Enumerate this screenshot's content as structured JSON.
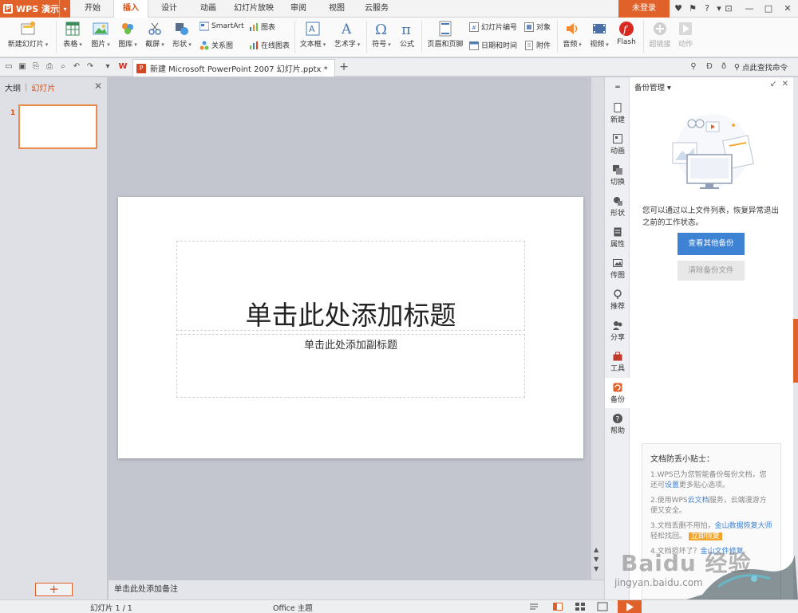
{
  "app": {
    "name": "WPS 演示"
  },
  "tabs": [
    {
      "label": "开始",
      "active": false
    },
    {
      "label": "插入",
      "active": true
    },
    {
      "label": "设计",
      "active": false
    },
    {
      "label": "动画",
      "active": false
    },
    {
      "label": "幻灯片放映",
      "active": false
    },
    {
      "label": "审阅",
      "active": false
    },
    {
      "label": "视图",
      "active": false
    },
    {
      "label": "云服务",
      "active": false
    }
  ],
  "account": {
    "login_label": "未登录"
  },
  "ribbon": {
    "new_slide": "新建幻灯片",
    "table": "表格",
    "picture": "图片",
    "gallery": "图库",
    "screenshot": "截屏",
    "shape": "形状",
    "smartart": "SmartArt",
    "chart": "图表",
    "relation": "关系图",
    "online_chart": "在线图表",
    "textbox": "文本框",
    "wordart": "艺术字",
    "symbol": "符号",
    "formula": "公式",
    "header_footer": "页眉和页脚",
    "slide_number": "幻灯片编号",
    "object": "对象",
    "datetime": "日期和时间",
    "attachment": "附件",
    "audio": "音频",
    "video": "视频",
    "flash": "Flash",
    "hyperlink": "超链接",
    "action": "动作"
  },
  "doc_tab": {
    "title": "新建 Microsoft PowerPoint 2007 幻灯片.pptx *",
    "add": "+"
  },
  "search": {
    "label": "点此查找命令"
  },
  "left_panel": {
    "outline_tab": "大纲",
    "slides_tab": "幻灯片",
    "thumb_number": "1",
    "add_button": "+"
  },
  "slide": {
    "title": "单击此处添加标题",
    "subtitle": "单击此处添加副标题"
  },
  "notes": {
    "placeholder": "单击此处添加备注"
  },
  "sidebar": [
    {
      "label": "新建",
      "icon": "new-icon"
    },
    {
      "label": "动画",
      "icon": "animation-icon"
    },
    {
      "label": "切换",
      "icon": "transition-icon"
    },
    {
      "label": "形状",
      "icon": "shape-icon"
    },
    {
      "label": "属性",
      "icon": "property-icon"
    },
    {
      "label": "传图",
      "icon": "upload-picture-icon"
    },
    {
      "label": "推荐",
      "icon": "recommend-icon"
    },
    {
      "label": "分享",
      "icon": "share-icon"
    },
    {
      "label": "工具",
      "icon": "toolbox-icon"
    },
    {
      "label": "备份",
      "icon": "backup-icon",
      "active": true
    },
    {
      "label": "帮助",
      "icon": "help-icon"
    }
  ],
  "backup_pane": {
    "title": "备份管理",
    "description": "您可以通过以上文件列表，恢复异常退出之前的工作状态。",
    "view_button": "查看其他备份",
    "clear_button": "清除备份文件",
    "tips_title": "文档防丢小贴士：",
    "tip1_a": "1.WPS已为您智能备份每份文档，您还可",
    "tip1_link": "设置",
    "tip1_b": "更多贴心选项。",
    "tip2_a": "2.使用WPS",
    "tip2_link": "云文档",
    "tip2_b": "服务，云端漫游方便又安全。",
    "tip3_a": "3.文档丢删不用怕，",
    "tip3_link": "金山数据恢复大师",
    "tip3_b": "轻松找回。",
    "tip3_badge": "立即恢复",
    "tip4": "4.文档损坏了？",
    "tip4_link": "金山文件修复"
  },
  "watermark": {
    "line1": "Baidu 经验",
    "line2": "jingyan.baidu.com"
  },
  "statusbar": {
    "slide_info": "幻灯片 1 / 1",
    "theme": "Office 主题"
  },
  "colors": {
    "accent": "#e0622a",
    "primary_button": "#3e82d3",
    "tab_active_text": "#d2531c"
  }
}
